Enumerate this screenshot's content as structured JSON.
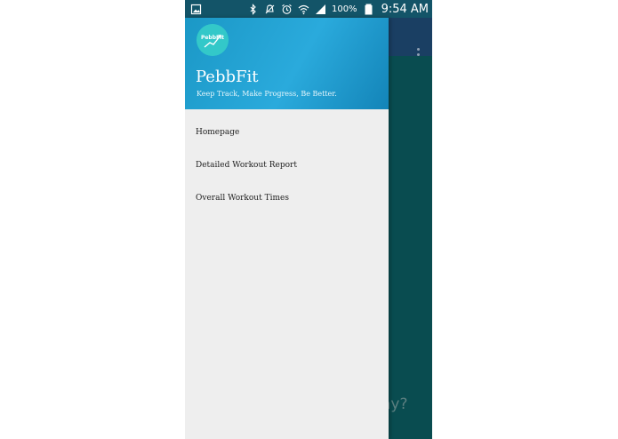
{
  "status_bar": {
    "left_icons": [
      "gallery-notification-icon"
    ],
    "right_icons": [
      "bluetooth-icon",
      "vibrate-icon",
      "alarm-icon",
      "wifi-icon",
      "signal-icon",
      "battery-icon"
    ],
    "battery_percent": "100%",
    "time": "9:54 AM"
  },
  "drawer": {
    "logo_text": "PebbFit",
    "app_name": "PebbFit",
    "tagline": "Keep Track, Make Progress, Be Better.",
    "menu_items": [
      {
        "label": "Homepage"
      },
      {
        "label": "Detailed Workout Report"
      },
      {
        "label": "Overall Workout Times"
      }
    ]
  },
  "background": {
    "partial_text": "ay?",
    "overflow_icon": "more-vert-icon"
  },
  "colors": {
    "header_gradient_start": "#1b98c6",
    "header_gradient_end": "#1384b8",
    "drawer_bg": "#eeeeee",
    "status_bar": "#135468",
    "bg_toolbar": "#1a3f63",
    "bg_content": "#094c50"
  }
}
